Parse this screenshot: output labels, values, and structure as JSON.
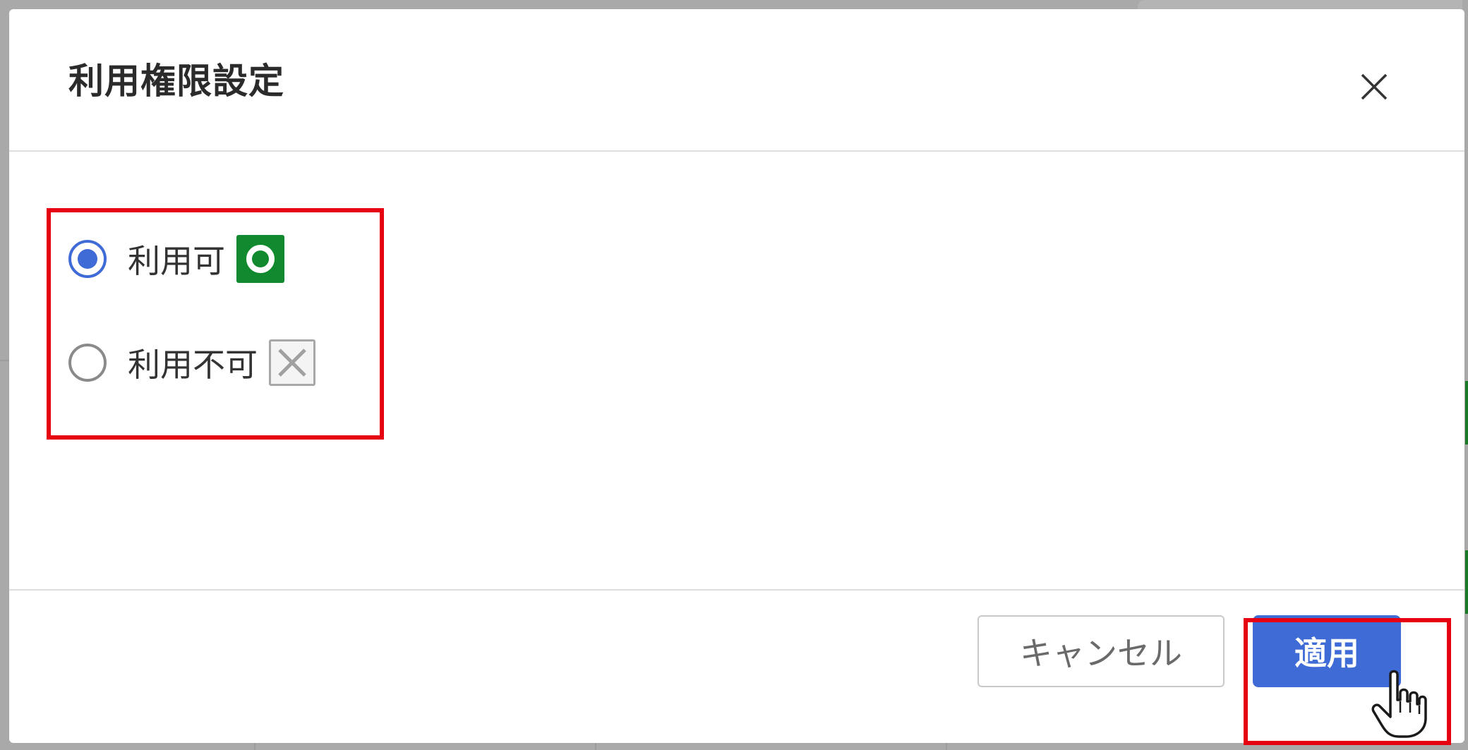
{
  "dialog": {
    "title": "利用権限設定",
    "close_icon": "close-icon"
  },
  "options": [
    {
      "label": "利用可",
      "checked": true,
      "icon": "available-circle-icon",
      "icon_color": "#11892f"
    },
    {
      "label": "利用不可",
      "checked": false,
      "icon": "unavailable-cross-icon",
      "icon_color": "#a8a8a8"
    }
  ],
  "footer": {
    "cancel_label": "キャンセル",
    "apply_label": "適用"
  },
  "colors": {
    "accent": "#3f6bd6",
    "highlight": "#e60012",
    "available": "#11892f"
  },
  "cursor_icon": "hand-pointer-icon"
}
